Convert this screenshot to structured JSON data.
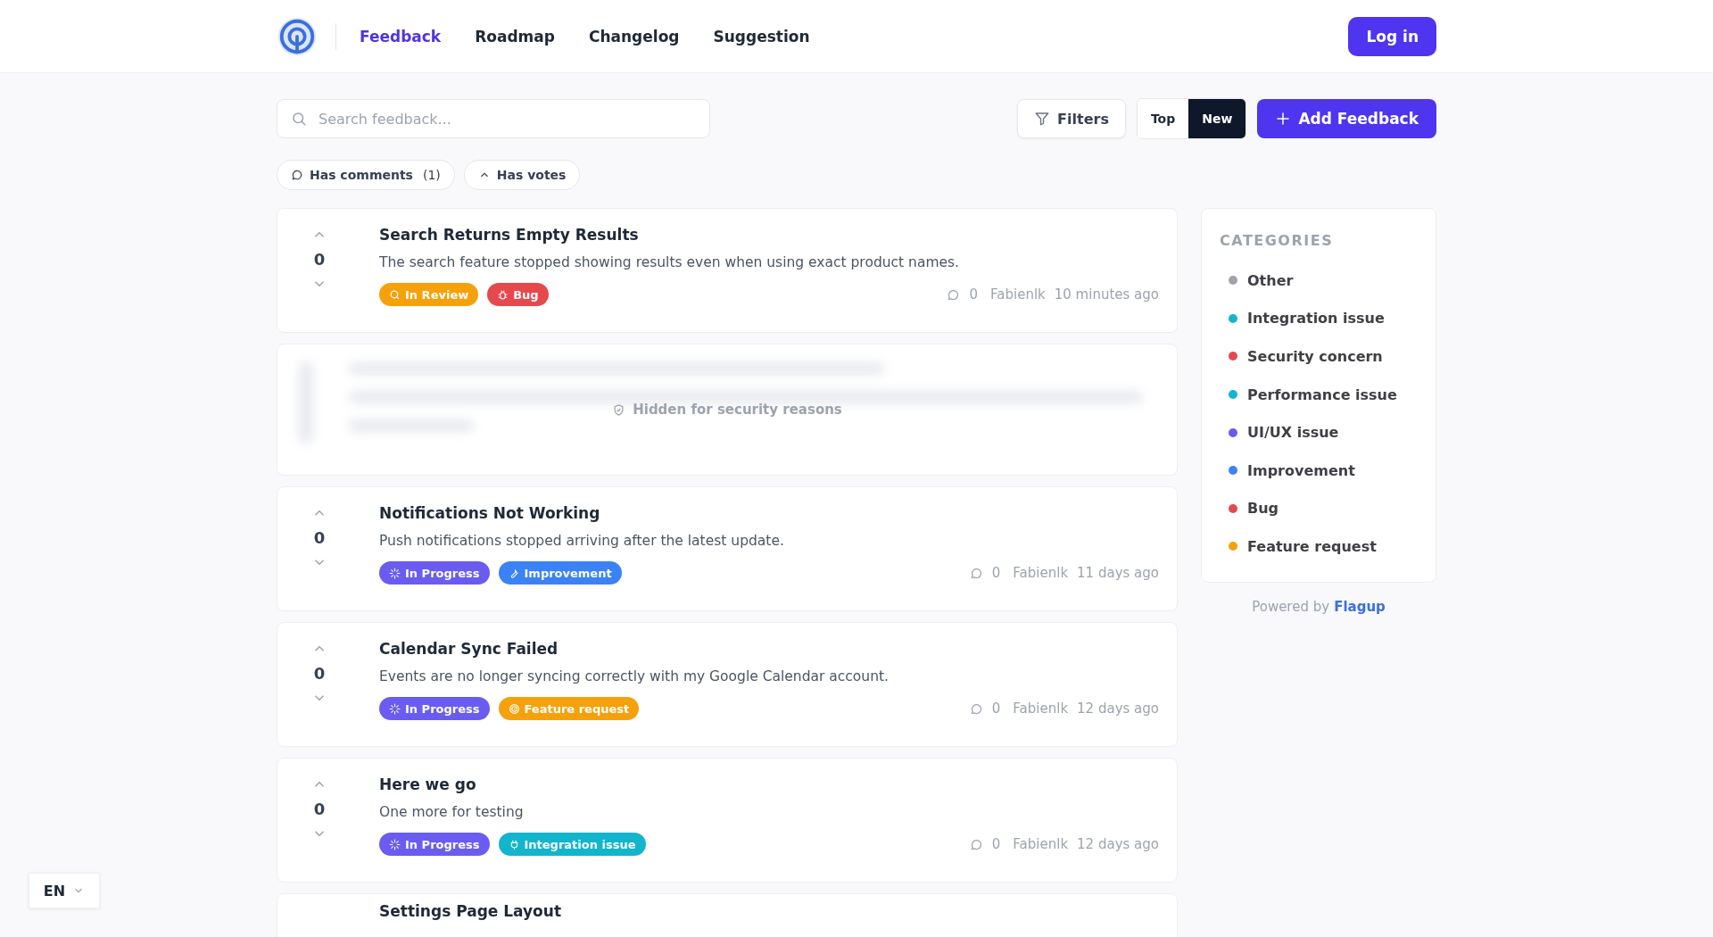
{
  "nav": {
    "items": [
      {
        "label": "Feedback",
        "selected": true
      },
      {
        "label": "Roadmap",
        "selected": false
      },
      {
        "label": "Changelog",
        "selected": false
      },
      {
        "label": "Suggestion",
        "selected": false
      }
    ],
    "login": "Log in"
  },
  "toolbar": {
    "search": {
      "placeholder": "Search feedback..."
    },
    "filters": "Filters",
    "sort": [
      {
        "label": "Top",
        "selected": false
      },
      {
        "label": "New",
        "selected": true
      }
    ],
    "add": "Add Feedback"
  },
  "chips": [
    {
      "kind": "comments",
      "label": "Has comments",
      "count": "(1)"
    },
    {
      "kind": "votes",
      "label": "Has votes"
    }
  ],
  "feed": [
    {
      "kind": "post",
      "votes": "0",
      "title": "Search Returns Empty Results",
      "description": "The search feature stopped showing results even when using exact product names.",
      "tags": [
        {
          "kind": "review",
          "label": "In Review",
          "color": "#f5a10b"
        },
        {
          "kind": "bug",
          "label": "Bug",
          "color": "#e5484d"
        }
      ],
      "comments": "0",
      "author": "Fabienlk",
      "time": "10 minutes ago"
    },
    {
      "kind": "hidden",
      "message": "Hidden for security reasons"
    },
    {
      "kind": "post",
      "votes": "0",
      "title": "Notifications Not Working",
      "description": "Push notifications stopped arriving after the latest update.",
      "tags": [
        {
          "kind": "progress",
          "label": "In Progress",
          "color": "#6a5cf0"
        },
        {
          "kind": "improvement",
          "label": "Improvement",
          "color": "#3b82f6"
        }
      ],
      "comments": "0",
      "author": "Fabienlk",
      "time": "11 days ago"
    },
    {
      "kind": "post",
      "votes": "0",
      "title": "Calendar Sync Failed",
      "description": "Events are no longer syncing correctly with my Google Calendar account.",
      "tags": [
        {
          "kind": "progress",
          "label": "In Progress",
          "color": "#6a5cf0"
        },
        {
          "kind": "feature",
          "label": "Feature request",
          "color": "#f5a10b"
        }
      ],
      "comments": "0",
      "author": "Fabienlk",
      "time": "12 days ago"
    },
    {
      "kind": "post",
      "votes": "0",
      "title": "Here we go",
      "description": "One more for testing",
      "tags": [
        {
          "kind": "progress",
          "label": "In Progress",
          "color": "#6a5cf0"
        },
        {
          "kind": "integration",
          "label": "Integration issue",
          "color": "#13b5cc"
        }
      ],
      "comments": "0",
      "author": "Fabienlk",
      "time": "12 days ago"
    },
    {
      "kind": "partial",
      "title": "Settings Page Layout"
    }
  ],
  "categories": {
    "title": "CATEGORIES",
    "items": [
      {
        "label": "Other",
        "color": "#a1a1aa"
      },
      {
        "label": "Integration issue",
        "color": "#13b5cc"
      },
      {
        "label": "Security concern",
        "color": "#e5484d"
      },
      {
        "label": "Performance issue",
        "color": "#13b5cc"
      },
      {
        "label": "UI/UX issue",
        "color": "#6a5cf0"
      },
      {
        "label": "Improvement",
        "color": "#3b82f6"
      },
      {
        "label": "Bug",
        "color": "#e5484d"
      },
      {
        "label": "Feature request",
        "color": "#f5a10b"
      }
    ]
  },
  "powered": {
    "text": "Powered by",
    "link": "Flagup"
  },
  "language": "EN"
}
